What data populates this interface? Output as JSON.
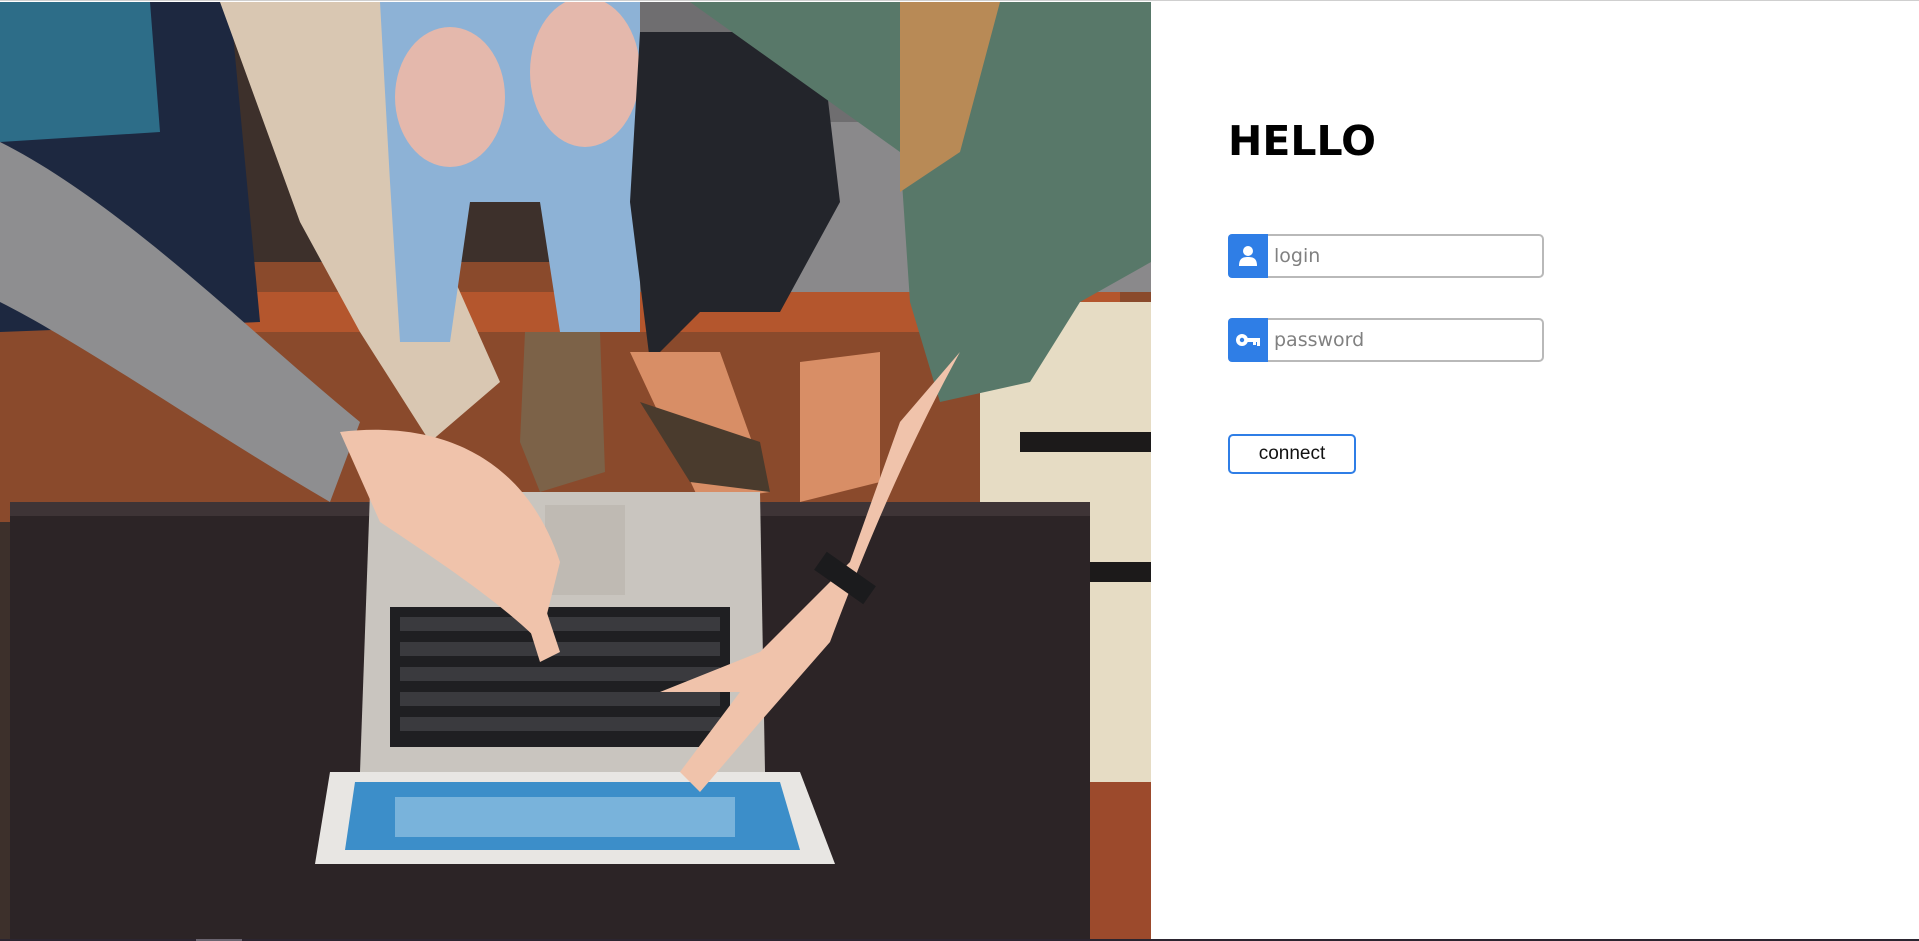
{
  "login": {
    "title": "HELLO",
    "login_field": {
      "placeholder": "login",
      "value": "",
      "icon": "user-icon"
    },
    "password_field": {
      "placeholder": "password",
      "value": "",
      "icon": "key-icon"
    },
    "connect_label": "connect"
  },
  "colors": {
    "accent": "#2f7ee6",
    "input_border": "#b9b9b9",
    "title": "#000000"
  }
}
